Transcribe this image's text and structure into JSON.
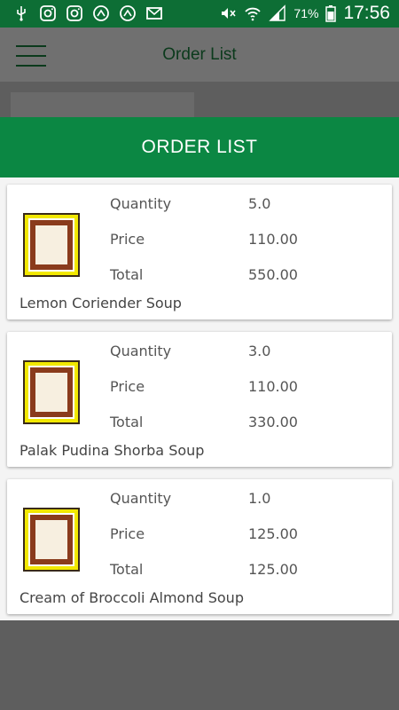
{
  "status_bar": {
    "battery_percent": "71%",
    "time": "17:56",
    "left_icons": [
      "usb-icon",
      "instagram-icon",
      "instagram-icon",
      "app-icon",
      "app-icon",
      "mail-icon"
    ],
    "right_icons": [
      "mute-icon",
      "wifi-icon",
      "signal-icon",
      "battery-icon"
    ]
  },
  "app_bar": {
    "title": "Order List"
  },
  "dialog": {
    "title": "ORDER LIST",
    "labels": {
      "quantity": "Quantity",
      "price": "Price",
      "total": "Total"
    },
    "items": [
      {
        "name": "Lemon Coriender Soup",
        "quantity": "5.0",
        "price": "110.00",
        "total": "550.00"
      },
      {
        "name": "Palak Pudina Shorba Soup",
        "quantity": "3.0",
        "price": "110.00",
        "total": "330.00"
      },
      {
        "name": "Cream of Broccoli Almond Soup",
        "quantity": "1.0",
        "price": "125.00",
        "total": "125.00"
      }
    ]
  },
  "colors": {
    "status_bar": "#0d6e35",
    "dialog_header": "#0b8743",
    "dim_overlay": "#5e5e5e"
  }
}
